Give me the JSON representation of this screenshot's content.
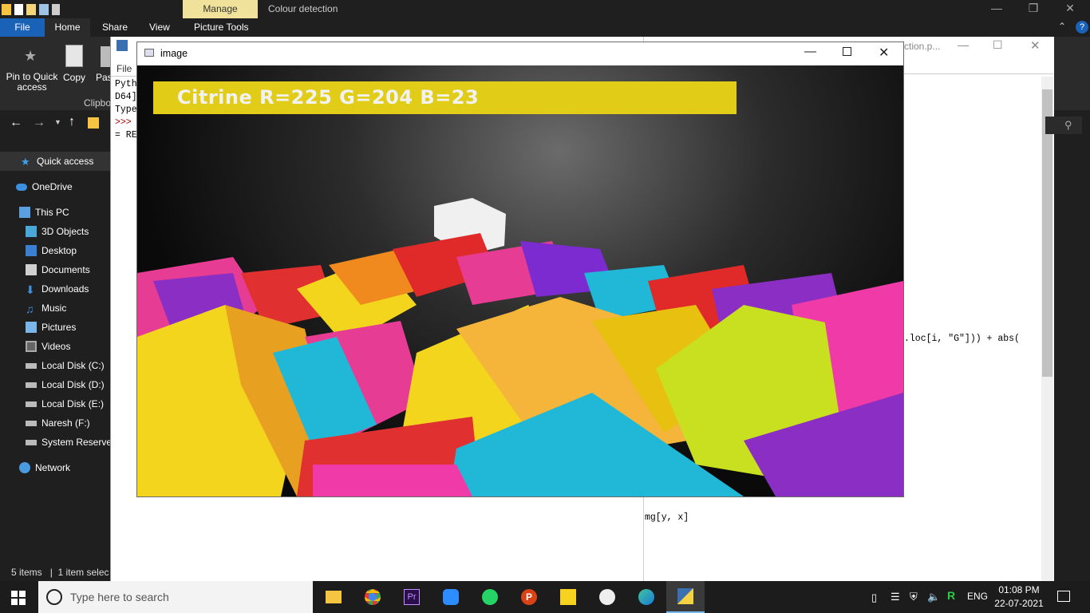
{
  "explorer": {
    "manage_tab": "Manage",
    "window_title": "Colour detection",
    "tabs": [
      "File",
      "Home",
      "Share",
      "View",
      "Picture Tools"
    ],
    "ribbon": {
      "pin_label": "Pin to Quick access",
      "copy_label": "Copy",
      "paste_label": "Pas",
      "clipboard_group": "Clipbo"
    },
    "sidebar": [
      {
        "label": "Quick access"
      },
      {
        "label": "OneDrive"
      },
      {
        "label": "This PC"
      },
      {
        "label": "3D Objects"
      },
      {
        "label": "Desktop"
      },
      {
        "label": "Documents"
      },
      {
        "label": "Downloads"
      },
      {
        "label": "Music"
      },
      {
        "label": "Pictures"
      },
      {
        "label": "Videos"
      },
      {
        "label": "Local Disk (C:)"
      },
      {
        "label": "Local Disk (D:)"
      },
      {
        "label": "Local Disk (E:)"
      },
      {
        "label": "Naresh (F:)"
      },
      {
        "label": "System Reserved"
      },
      {
        "label": "Network"
      }
    ],
    "status": {
      "items": "5 items",
      "selected": "1 item selec"
    }
  },
  "idle_left": {
    "menu": "File",
    "lines": [
      "Pyth",
      "D64]",
      "Type",
      ">>>",
      "= RE"
    ]
  },
  "idle_right": {
    "title_fragment": "ction.p...",
    "code1": ".loc[i, \"G\"])) + abs(",
    "code2": "mg[y, x]"
  },
  "image_window": {
    "title": "image",
    "detected": {
      "text": "Citrine R=225 G=204 B=23",
      "color": "#e1cc17"
    }
  },
  "taskbar": {
    "search_placeholder": "Type here to search",
    "language": "ENG",
    "time": "01:08 PM",
    "date": "22-07-2021"
  },
  "colors": {
    "accent": "#1a62b8",
    "manage": "#f0e29a",
    "banner": "#e1cc17"
  }
}
